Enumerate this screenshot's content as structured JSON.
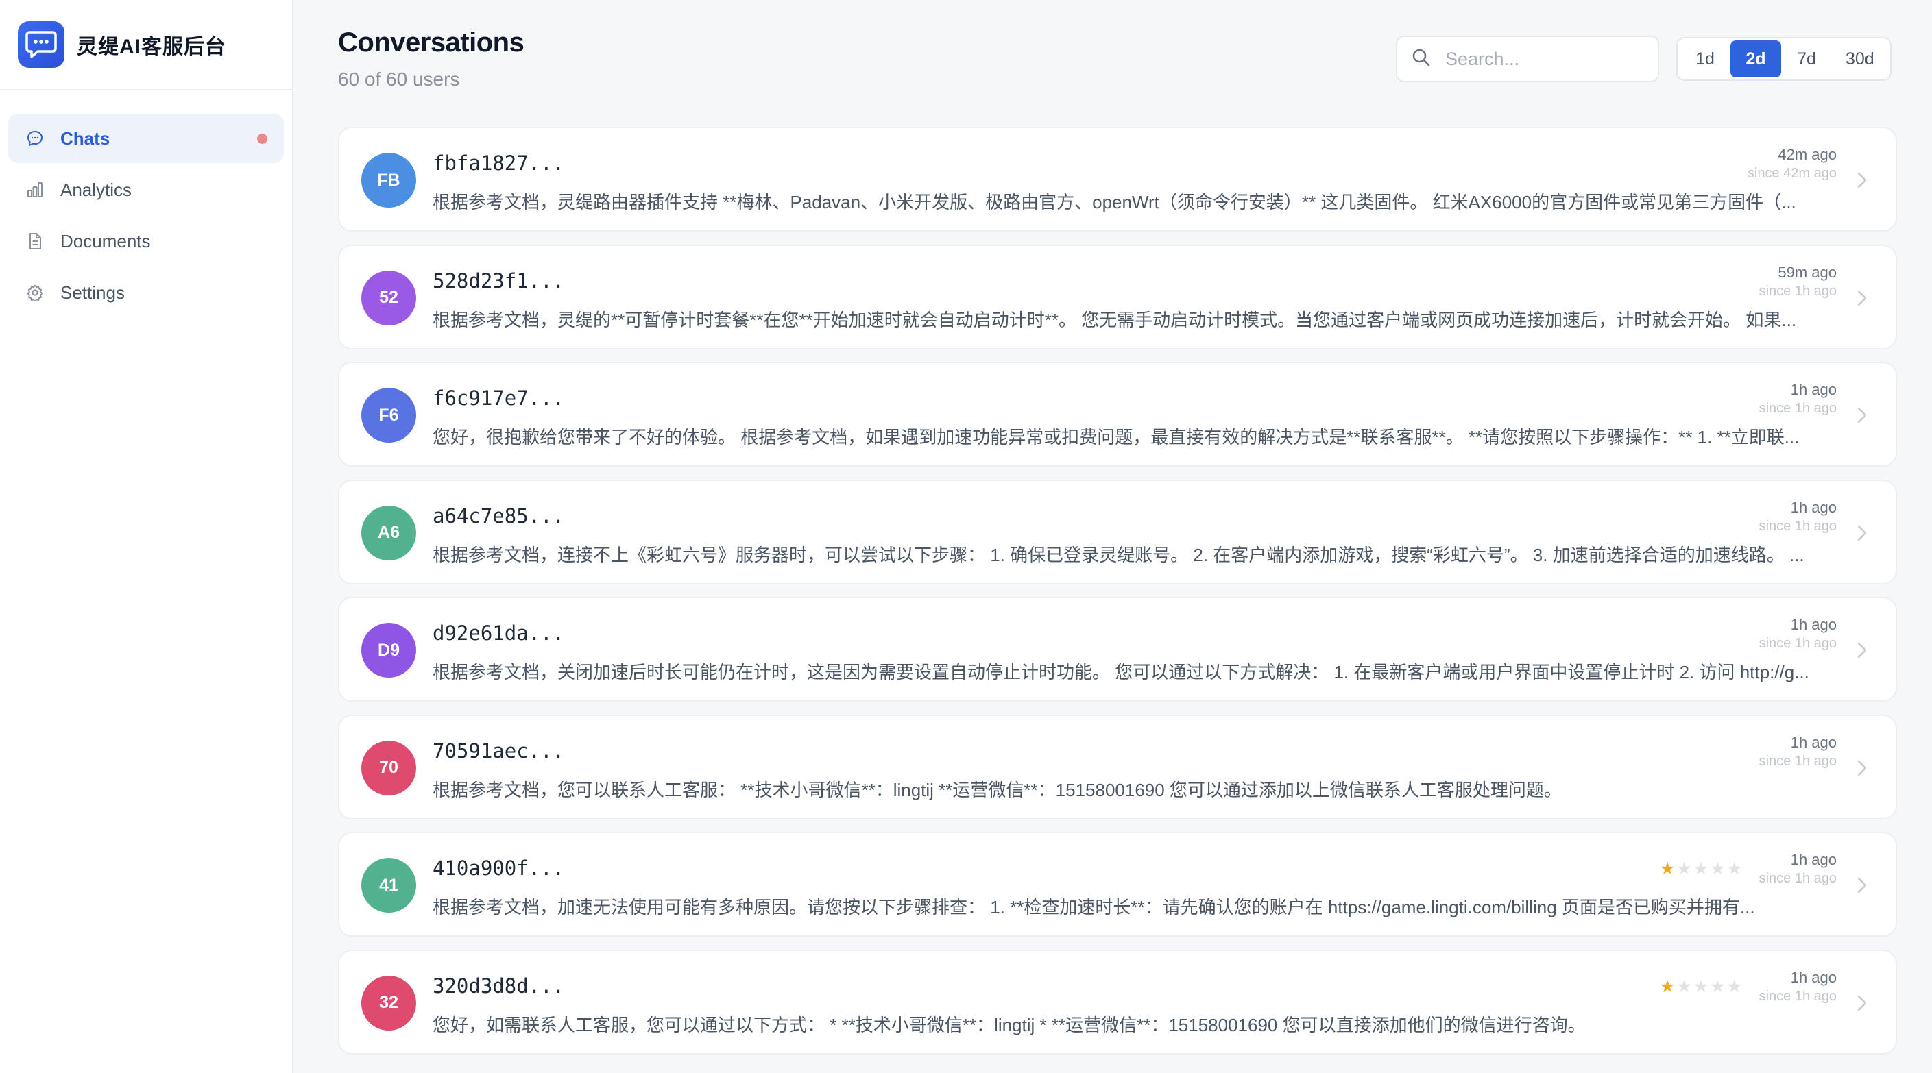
{
  "app": {
    "title": "灵缇AI客服后台"
  },
  "sidebar": {
    "items": [
      {
        "label": "Chats",
        "icon": "chat-bubble-icon",
        "active": true,
        "badge": true
      },
      {
        "label": "Analytics",
        "icon": "bar-chart-icon",
        "active": false
      },
      {
        "label": "Documents",
        "icon": "document-icon",
        "active": false
      },
      {
        "label": "Settings",
        "icon": "gear-icon",
        "active": false
      }
    ]
  },
  "header": {
    "title": "Conversations",
    "subtitle": "60 of 60 users"
  },
  "search": {
    "placeholder": "Search..."
  },
  "range": {
    "options": [
      "1d",
      "2d",
      "7d",
      "30d"
    ],
    "selected": "2d"
  },
  "colors": {
    "accent": "#2f63de",
    "star": "#f0a81c",
    "badge": "#e78a8a"
  },
  "conversations": [
    {
      "avatar": "FB",
      "avatar_color": "#4b8fe3",
      "id": "fbfa1827...",
      "preview": "根据参考文档，灵缇路由器插件支持 **梅林、Padavan、小米开发版、极路由官方、openWrt（须命令行安装）** 这几类固件。 红米AX6000的官方固件或常见第三方固件（...",
      "time": "42m ago",
      "since": "since 42m ago"
    },
    {
      "avatar": "52",
      "avatar_color": "#9a5ae6",
      "id": "528d23f1...",
      "preview": "根据参考文档，灵缇的**可暂停计时套餐**在您**开始加速时就会自动启动计时**。 您无需手动启动计时模式。当您通过客户端或网页成功连接加速后，计时就会开始。 如果...",
      "time": "59m ago",
      "since": "since 1h ago"
    },
    {
      "avatar": "F6",
      "avatar_color": "#5973e2",
      "id": "f6c917e7...",
      "preview": "您好，很抱歉给您带来了不好的体验。 根据参考文档，如果遇到加速功能异常或扣费问题，最直接有效的解决方式是**联系客服**。 **请您按照以下步骤操作：** 1. **立即联...",
      "time": "1h ago",
      "since": "since 1h ago"
    },
    {
      "avatar": "A6",
      "avatar_color": "#52b28f",
      "id": "a64c7e85...",
      "preview": "根据参考文档，连接不上《彩虹六号》服务器时，可以尝试以下步骤： 1. 确保已登录灵缇账号。 2. 在客户端内添加游戏，搜索“彩虹六号”。 3. 加速前选择合适的加速线路。 ...",
      "time": "1h ago",
      "since": "since 1h ago"
    },
    {
      "avatar": "D9",
      "avatar_color": "#8f55e4",
      "id": "d92e61da...",
      "preview": "根据参考文档，关闭加速后时长可能仍在计时，这是因为需要设置自动停止计时功能。 您可以通过以下方式解决： 1. 在最新客户端或用户界面中设置停止计时 2. 访问 http://g...",
      "time": "1h ago",
      "since": "since 1h ago"
    },
    {
      "avatar": "70",
      "avatar_color": "#df4b6f",
      "id": "70591aec...",
      "preview": "根据参考文档，您可以联系人工客服： **技术小哥微信**：lingtij **运营微信**：15158001690 您可以通过添加以上微信联系人工客服处理问题。",
      "time": "1h ago",
      "since": "since 1h ago"
    },
    {
      "avatar": "41",
      "avatar_color": "#52b28f",
      "id": "410a900f...",
      "preview": "根据参考文档，加速无法使用可能有多种原因。请您按以下步骤排查： 1. **检查加速时长**：请先确认您的账户在 https://game.lingti.com/billing 页面是否已购买并拥有...",
      "time": "1h ago",
      "since": "since 1h ago",
      "rating": 1
    },
    {
      "avatar": "32",
      "avatar_color": "#df4b6f",
      "id": "320d3d8d...",
      "preview": "您好，如需联系人工客服，您可以通过以下方式： * **技术小哥微信**：lingtij * **运营微信**：15158001690 您可以直接添加他们的微信进行咨询。",
      "time": "1h ago",
      "since": "since 1h ago",
      "rating": 1
    }
  ]
}
